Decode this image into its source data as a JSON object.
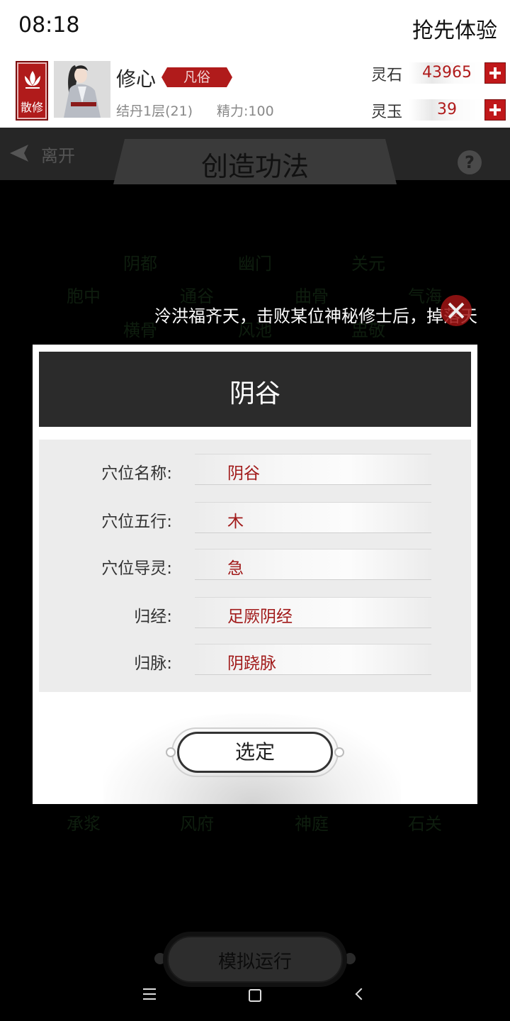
{
  "status_bar": {
    "time": "08:18",
    "right_text": "抢先体验"
  },
  "player": {
    "sect": "散修",
    "name": "修心",
    "rank": "凡俗",
    "realm": "结丹1层(21)",
    "energy": "精力:100"
  },
  "resources": [
    {
      "label": "灵石",
      "value": "43965"
    },
    {
      "label": "灵玉",
      "value": "39"
    }
  ],
  "nav": {
    "back_label": "离开",
    "title": "创造功法",
    "help": "?"
  },
  "grid_nodes": [
    "阴都",
    "幽门",
    "关元",
    "胞中",
    "通谷",
    "曲骨",
    "气海",
    "横骨",
    "风池",
    "盅敬",
    "承浆",
    "风府",
    "神庭",
    "石关"
  ],
  "marquee": "泠洪福齐天，击败某位神秘修士后，掉落天",
  "dialog": {
    "title": "阴谷",
    "rows": [
      {
        "label": "穴位名称:",
        "value": "阴谷"
      },
      {
        "label": "穴位五行:",
        "value": "木"
      },
      {
        "label": "穴位导灵:",
        "value": "急"
      },
      {
        "label": "归经:",
        "value": "足厥阴经"
      },
      {
        "label": "归脉:",
        "value": "阴跷脉"
      }
    ],
    "confirm_label": "选定"
  },
  "simulate_label": "模拟运行",
  "colors": {
    "accent_red": "#b01b1b",
    "value_red": "#a11a1a",
    "dialog_header": "#2b2b2b"
  }
}
